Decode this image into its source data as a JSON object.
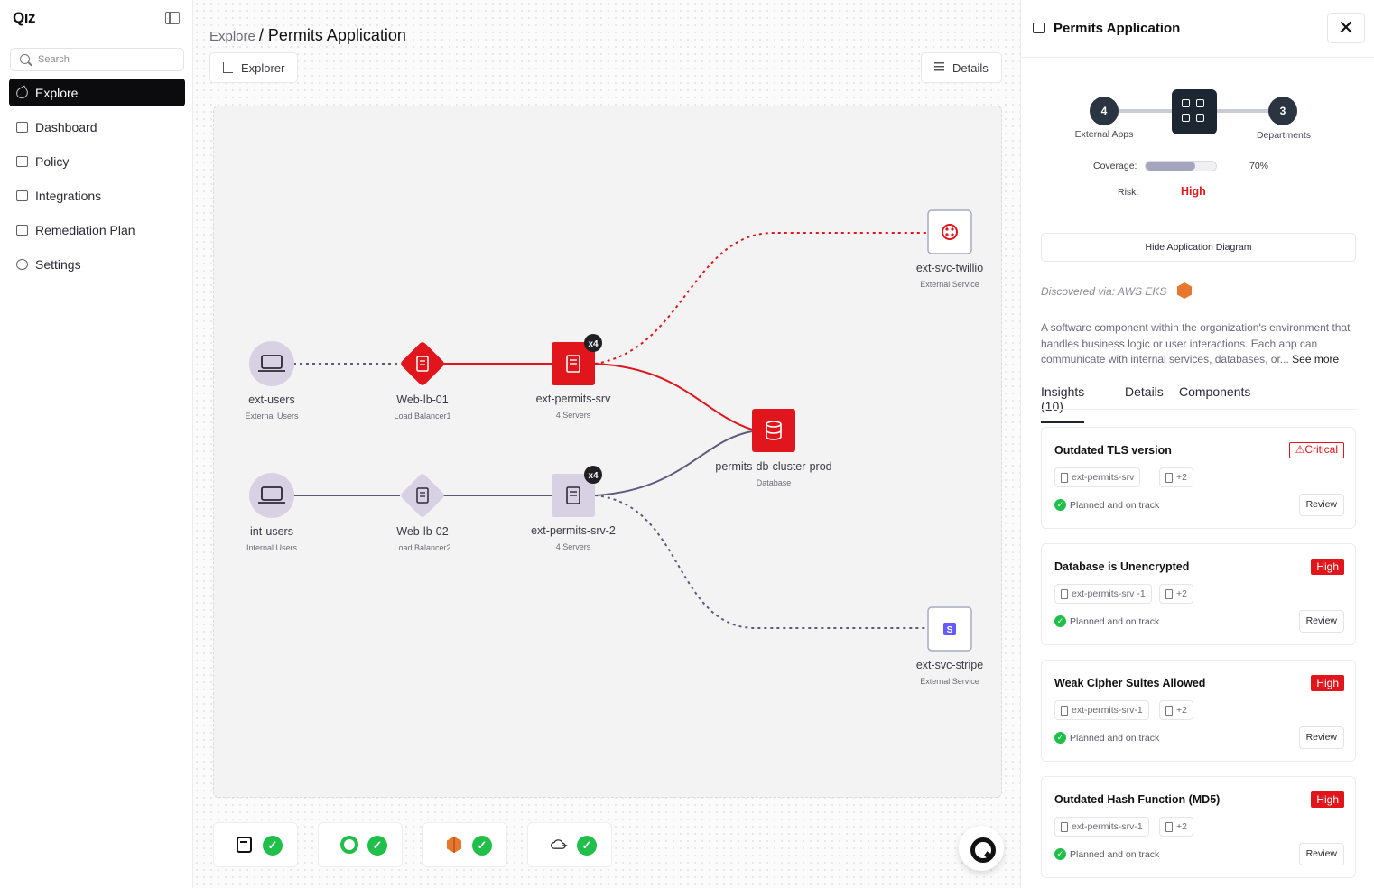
{
  "app": {
    "logo": "Qız"
  },
  "sidebar": {
    "search_placeholder": "Search",
    "items": [
      {
        "label": "Explore",
        "icon": "telescope-icon",
        "active": true
      },
      {
        "label": "Dashboard",
        "icon": "dashboard-icon"
      },
      {
        "label": "Policy",
        "icon": "policy-icon"
      },
      {
        "label": "Integrations",
        "icon": "integrations-icon"
      },
      {
        "label": "Remediation Plan",
        "icon": "remediation-icon"
      },
      {
        "label": "Settings",
        "icon": "gear-icon"
      }
    ]
  },
  "main": {
    "breadcrumb": {
      "root": "Explore",
      "current": "Permits Application"
    },
    "explorer_button": "Explorer",
    "details_button": "Details"
  },
  "graph": {
    "nodes": [
      {
        "id": "ext-users",
        "label": "ext-users",
        "sub": "External Users",
        "kind": "user",
        "color": "#d8d1e3"
      },
      {
        "id": "web-lb-01",
        "label": "Web-lb-01",
        "sub": "Load Balancer1",
        "kind": "diamond",
        "color": "#e0161c"
      },
      {
        "id": "ext-permits-srv",
        "label": "ext-permits-srv",
        "sub": "4 Servers",
        "kind": "server",
        "color": "#e0161c",
        "badge": "x4"
      },
      {
        "id": "int-users",
        "label": "int-users",
        "sub": "Internal Users",
        "kind": "user",
        "color": "#d8d1e3"
      },
      {
        "id": "web-lb-02",
        "label": "Web-lb-02",
        "sub": "Load Balancer2",
        "kind": "diamond",
        "color": "#d8d1e3"
      },
      {
        "id": "ext-permits-srv-2",
        "label": "ext-permits-srv-2",
        "sub": "4 Servers",
        "kind": "server",
        "color": "#d8d1e3",
        "badge": "x4"
      },
      {
        "id": "permits-db",
        "label": "permits-db-cluster-prod",
        "sub": "Database",
        "kind": "database",
        "color": "#e0161c"
      },
      {
        "id": "ext-svc-twillio",
        "label": "ext-svc-twillio",
        "sub": "External Service",
        "kind": "external",
        "color": "#e0161c"
      },
      {
        "id": "ext-svc-stripe",
        "label": "ext-svc-stripe",
        "sub": "External Service",
        "kind": "external",
        "color": "#635bff"
      }
    ]
  },
  "integrations": [
    {
      "icon": "qoz-book-icon",
      "status": "ok"
    },
    {
      "icon": "green-ring-icon",
      "status": "ok"
    },
    {
      "icon": "aws-icon",
      "status": "ok"
    },
    {
      "icon": "cloud-plug-icon",
      "status": "ok"
    }
  ],
  "panel": {
    "title": "Permits Application",
    "stepper": {
      "left_count": "4",
      "left_label": "External Apps",
      "right_count": "3",
      "right_label": "Departments"
    },
    "coverage": {
      "label": "Coverage:",
      "value": "70%",
      "fraction": 0.7
    },
    "risk": {
      "label": "Risk:",
      "value": "High"
    },
    "hide_button": "Hide Application Diagram",
    "discovered": "Discovered via: AWS EKS",
    "description": "A software component within the organization's environment that handles business logic or user interactions. Each app can communicate with internal services, databases, or...",
    "see_more": "See more",
    "tabs": [
      "Insights (10)",
      "Details",
      "Components"
    ],
    "insights": [
      {
        "title": "Outdated TLS version",
        "severity": "Critical",
        "resource": "ext-permits-srv",
        "extra": "+2",
        "status": "Planned and on track",
        "action": "Review"
      },
      {
        "title": "Database is Unencrypted",
        "severity": "High",
        "resource": "ext-permits-srv -1",
        "extra": "+2",
        "status": "Planned and on track",
        "action": "Review"
      },
      {
        "title": "Weak Cipher Suites Allowed",
        "severity": "High",
        "resource": "ext-permits-srv-1",
        "extra": "+2",
        "status": "Planned and on track",
        "action": "Review"
      },
      {
        "title": "Outdated Hash Function (MD5)",
        "severity": "High",
        "resource": "ext-permits-srv-1",
        "extra": "+2",
        "status": "Planned and on track",
        "action": "Review"
      }
    ]
  },
  "colors": {
    "accent_red": "#e0161c",
    "edge_purple": "#5e5a7e",
    "dark": "#1d2733"
  }
}
